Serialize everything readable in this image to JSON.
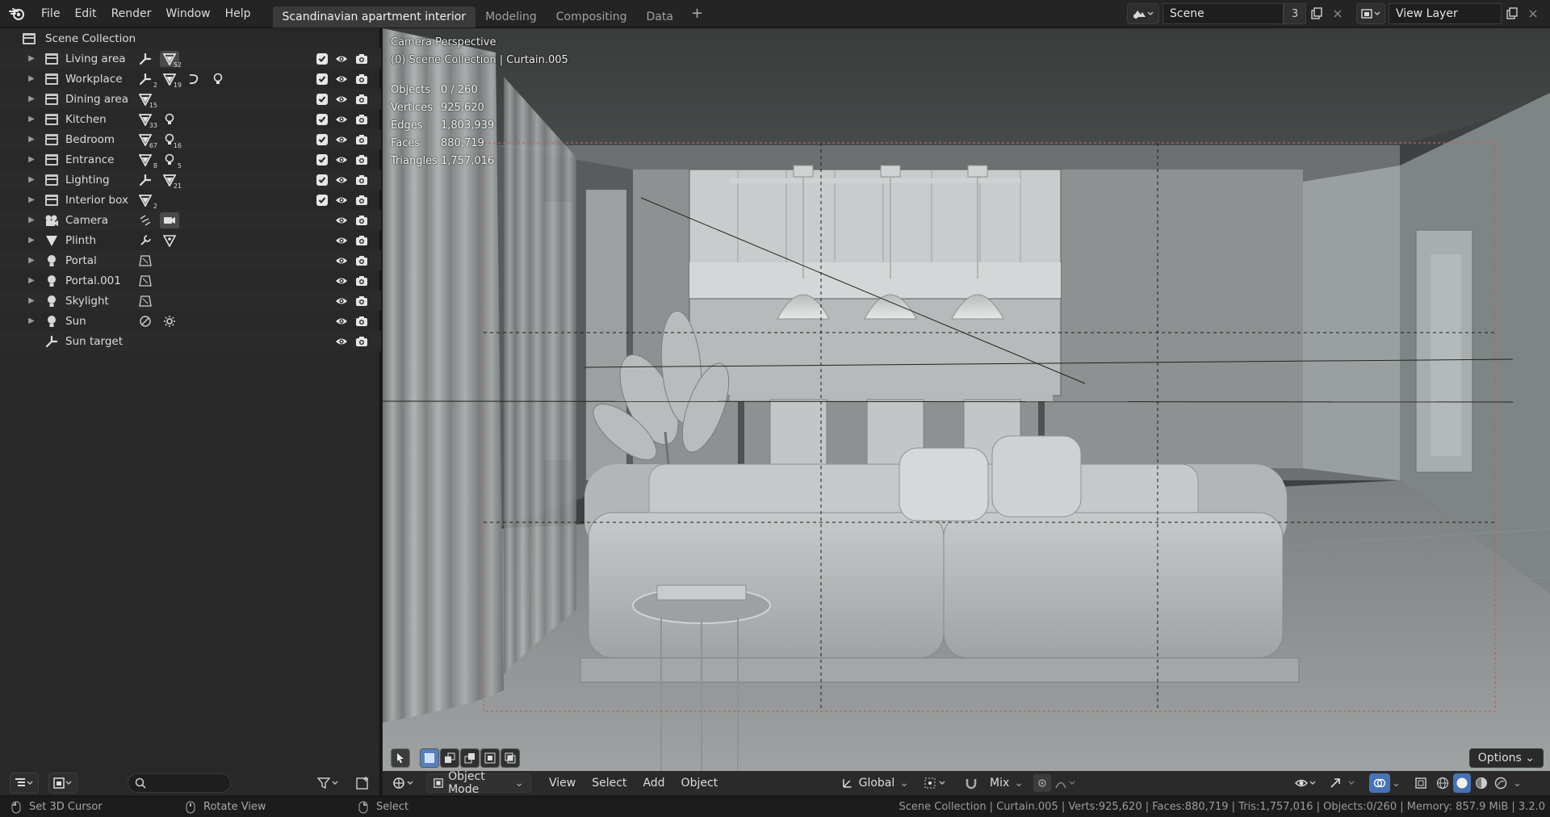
{
  "menu": {
    "items": [
      "File",
      "Edit",
      "Render",
      "Window",
      "Help"
    ]
  },
  "workspaces": {
    "tabs": [
      "Scandinavian apartment interior",
      "Modeling",
      "Compositing",
      "Data"
    ],
    "active": 0,
    "add_label": "+"
  },
  "scene": {
    "name": "Scene",
    "users": "3",
    "view_layer": "View Layer"
  },
  "outliner": {
    "root_label": "Scene Collection",
    "rows": [
      {
        "name": "Living area",
        "extra": [
          "armature",
          "mesh"
        ],
        "extra_counts": [
          "",
          "52"
        ],
        "checkbox": true
      },
      {
        "name": "Workplace",
        "extra": [
          "armature",
          "mesh",
          "curve",
          "light"
        ],
        "extra_counts": [
          "2",
          "19",
          "",
          ""
        ],
        "checkbox": true
      },
      {
        "name": "Dining area",
        "extra": [
          "mesh"
        ],
        "extra_counts": [
          "15"
        ],
        "checkbox": true
      },
      {
        "name": "Kitchen",
        "extra": [
          "mesh",
          "light"
        ],
        "extra_counts": [
          "33",
          ""
        ],
        "checkbox": true
      },
      {
        "name": "Bedroom",
        "extra": [
          "mesh",
          "light"
        ],
        "extra_counts": [
          "67",
          "16"
        ],
        "checkbox": true
      },
      {
        "name": "Entrance",
        "extra": [
          "mesh",
          "light"
        ],
        "extra_counts": [
          "8",
          "5"
        ],
        "checkbox": true
      },
      {
        "name": "Lighting",
        "extra": [
          "armature",
          "mesh"
        ],
        "extra_counts": [
          "",
          "21"
        ],
        "checkbox": true
      },
      {
        "name": "Interior box",
        "extra": [
          "mesh"
        ],
        "extra_counts": [
          "2"
        ],
        "checkbox": true
      },
      {
        "name": "Camera",
        "extra": [
          "constraint",
          "camera-data"
        ],
        "extra_counts": [
          "",
          ""
        ],
        "checkbox": false
      },
      {
        "name": "Plinth",
        "extra": [
          "wrench",
          "mesh-data"
        ],
        "extra_counts": [
          "",
          ""
        ],
        "checkbox": false
      },
      {
        "name": "Portal",
        "extra": [
          "light-data"
        ],
        "extra_counts": [
          ""
        ],
        "checkbox": false
      },
      {
        "name": "Portal.001",
        "extra": [
          "light-data"
        ],
        "extra_counts": [
          ""
        ],
        "checkbox": false
      },
      {
        "name": "Skylight",
        "extra": [
          "light-data"
        ],
        "extra_counts": [
          ""
        ],
        "checkbox": false
      },
      {
        "name": "Sun",
        "extra": [
          "constraint-target",
          "sun"
        ],
        "extra_counts": [
          "",
          ""
        ],
        "checkbox": false
      },
      {
        "name": "Sun target",
        "extra": [],
        "extra_counts": [],
        "checkbox": false
      }
    ]
  },
  "viewport": {
    "view_name": "Camera Perspective",
    "context": "(0) Scene Collection | Curtain.005",
    "stats": [
      {
        "label": "Objects",
        "value": "0 / 260"
      },
      {
        "label": "Vertices",
        "value": "925,620"
      },
      {
        "label": "Edges",
        "value": "1,803,939"
      },
      {
        "label": "Faces",
        "value": "880,719"
      },
      {
        "label": "Triangles",
        "value": "1,757,016"
      }
    ],
    "header": {
      "mode": "Object Mode",
      "menus": [
        "View",
        "Select",
        "Add",
        "Object"
      ],
      "transform": "Global",
      "snap_mix": "Mix"
    },
    "options_label": "Options"
  },
  "status": {
    "left_action": "Set 3D Cursor",
    "middle_action": "Rotate View",
    "right_action": "Select",
    "info": "Scene Collection | Curtain.005 | Verts:925,620 | Faces:880,719 | Tris:1,757,016 | Objects:0/260 | Memory: 857.9 MiB | 3.2.0"
  }
}
